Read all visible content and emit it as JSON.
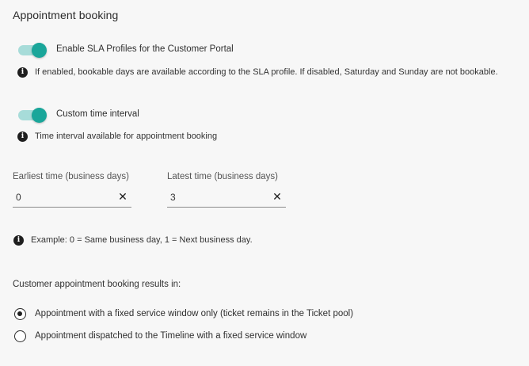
{
  "section": {
    "title": "Appointment booking"
  },
  "sla_toggle": {
    "label": "Enable SLA Profiles for the Customer Portal",
    "on": true,
    "info": "If enabled, bookable days are available according to the SLA profile. If disabled, Saturday and Sunday are not bookable."
  },
  "interval_toggle": {
    "label": "Custom time interval",
    "on": true,
    "info": "Time interval available for appointment booking"
  },
  "earliest": {
    "label": "Earliest time (business days)",
    "value": "0"
  },
  "latest": {
    "label": "Latest time (business days)",
    "value": "3"
  },
  "example": {
    "text": "Example: 0 = Same business day, 1 = Next business day."
  },
  "result": {
    "label": "Customer appointment booking results in:",
    "options": [
      {
        "label": "Appointment with a fixed service window only (ticket remains in the Ticket pool)",
        "selected": true
      },
      {
        "label": "Appointment dispatched to the Timeline with a fixed service window",
        "selected": false
      }
    ]
  },
  "colors": {
    "accent": "#1aa69a",
    "track": "#a7dcd9",
    "background": "#f7f7f7"
  },
  "icons": {
    "info": "info-icon",
    "clear": "close-icon"
  }
}
